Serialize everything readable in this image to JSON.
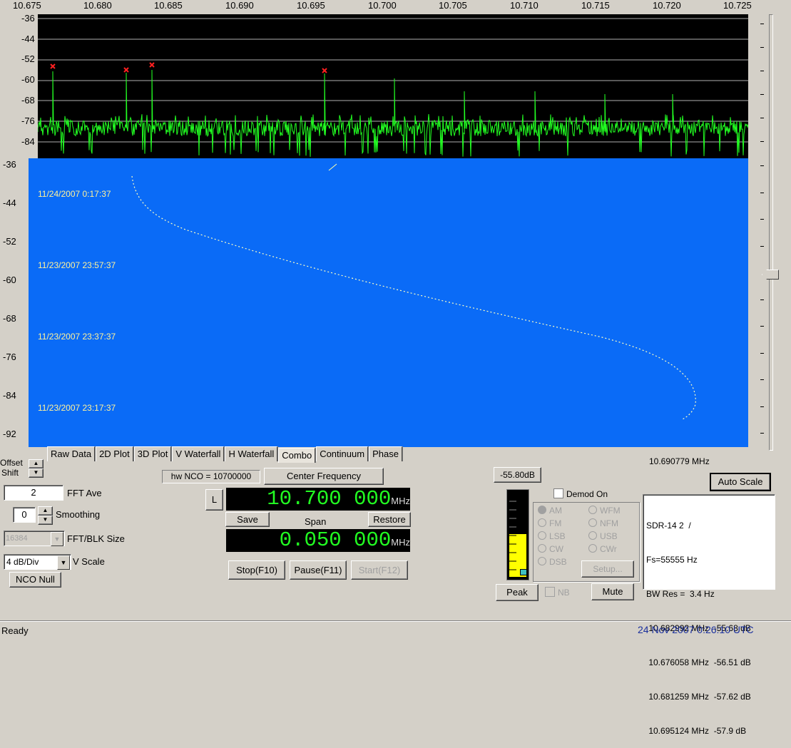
{
  "freq_axis": [
    "10.675",
    "10.680",
    "10.685",
    "10.690",
    "10.695",
    "10.700",
    "10.705",
    "10.710",
    "10.715",
    "10.720",
    "10.725"
  ],
  "spec_axis": [
    "-36",
    "-44",
    "-52",
    "-60",
    "-68",
    "-76",
    "-84"
  ],
  "wf_axis": [
    "-36",
    "-44",
    "-52",
    "-60",
    "-68",
    "-76",
    "-84",
    "-92"
  ],
  "timestamps": [
    "11/24/2007 0:17:37",
    "11/23/2007 23:57:37",
    "11/23/2007 23:37:37",
    "11/23/2007 23:17:37"
  ],
  "tabs": [
    "Raw Data",
    "2D Plot",
    "3D Plot",
    "V Waterfall",
    "H Waterfall",
    "Combo",
    "Continuum",
    "Phase"
  ],
  "active_tab": "Combo",
  "left": {
    "offset_label": "Offset",
    "shift_label": "Shift",
    "fft_ave_value": "2",
    "fft_ave_label": "FFT Ave",
    "smoothing_value": "0",
    "smoothing_label": "Smoothing",
    "fft_blk_value": "16384",
    "fft_blk_label": "FFT/BLK Size",
    "vscale_value": "4 dB/Div",
    "vscale_label": "V Scale",
    "nco_null": "NCO Null"
  },
  "center": {
    "hw_nco": "hw NCO = 10700000",
    "center_freq_btn": "Center Frequency",
    "l_btn": "L",
    "freq_display": "10.700 000",
    "freq_unit": "MHz",
    "save": "Save",
    "span_label": "Span",
    "restore": "Restore",
    "span_display": "0.050 000",
    "span_unit": "MHz",
    "stop": "Stop(F10)",
    "pause": "Pause(F11)",
    "start": "Start(F12)"
  },
  "demod": {
    "level_readout": "-55.80dB",
    "demod_on": "Demod On",
    "modes_left": [
      "AM",
      "FM",
      "LSB",
      "CW",
      "DSB"
    ],
    "modes_right": [
      "WFM",
      "NFM",
      "USB",
      "CWr"
    ],
    "setup": "Setup...",
    "peak": "Peak",
    "nb": "NB",
    "mute": "Mute"
  },
  "right": {
    "cursor_freq": "10.690779 MHz",
    "auto_scale": "Auto Scale",
    "info_lines": [
      "SDR-14 2  /",
      "Fs=55555 Hz",
      "BW Res =  3.4 Hz",
      " 10.682992 MHz  -55.68 dB",
      " 10.676058 MHz  -56.51 dB",
      " 10.681259 MHz  -57.62 dB",
      " 10.695124 MHz  -57.9 dB"
    ]
  },
  "status": {
    "left": "Ready",
    "right": "24 Nov 2007  0:26:10 UTC"
  },
  "colors": {
    "spectrum_bg": "#000000",
    "trace": "#22ff22",
    "waterfall": "#0a6bf7",
    "timestamp": "#fff29a",
    "status_blue": "#1a2f9c"
  }
}
